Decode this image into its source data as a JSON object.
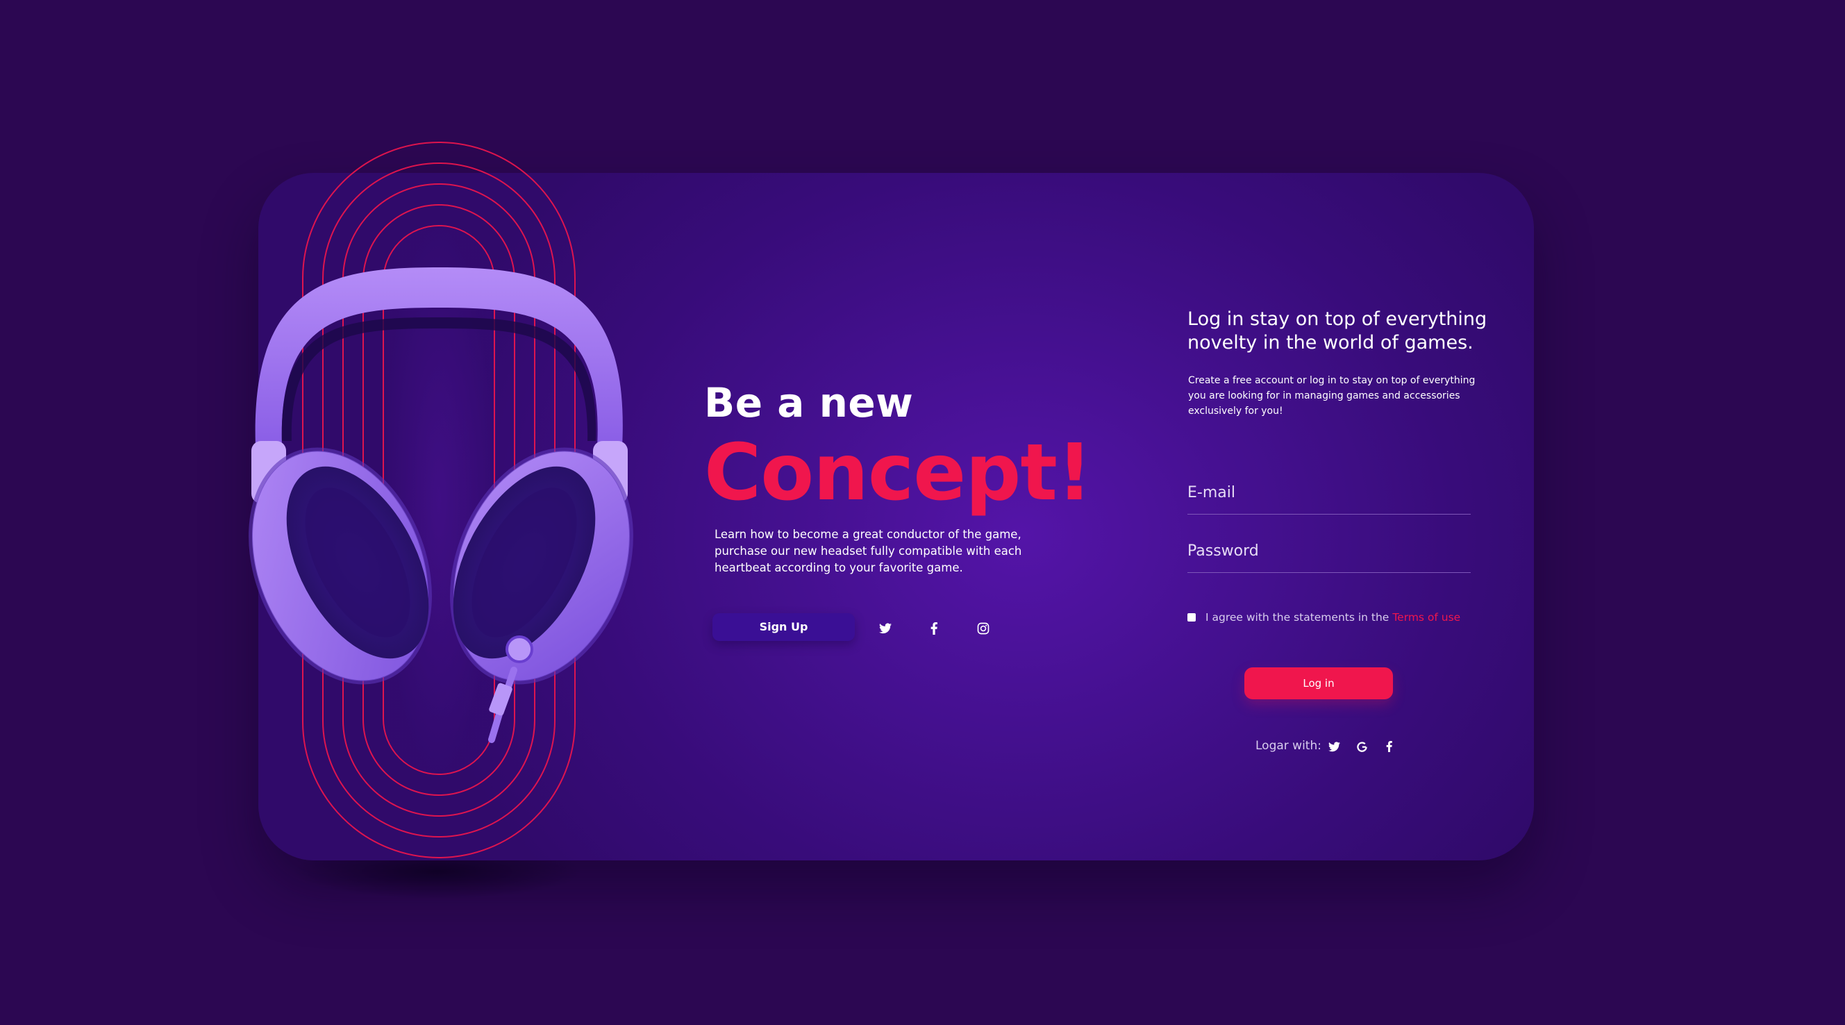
{
  "colors": {
    "background": "#2c0752",
    "card": "#44108f",
    "accent": "#f0164d",
    "headphones": "#a77df0",
    "signup_button": "#3a0f95"
  },
  "hero": {
    "line1": "Be a new",
    "line2": "Concept!",
    "description": "Learn how to become a great conductor of the game, purchase our new headset fully compatible with each heartbeat according to your favorite game.",
    "signup_label": "Sign Up",
    "social_icons": [
      "twitter-icon",
      "facebook-icon",
      "instagram-icon"
    ]
  },
  "login": {
    "title": "Log in stay on top of everything novelty in the world of games.",
    "description": "Create a free account or log in to stay on top of everything you are looking for in managing games and accessories exclusively for you!",
    "email_placeholder": "E-mail",
    "password_placeholder": "Password",
    "agree_text": "I agree with the statements in the",
    "terms_link": "Terms of use",
    "login_label": "Log in",
    "logar_label": "Logar with:",
    "social_icons": [
      "twitter-icon",
      "google-icon",
      "facebook-icon"
    ]
  }
}
